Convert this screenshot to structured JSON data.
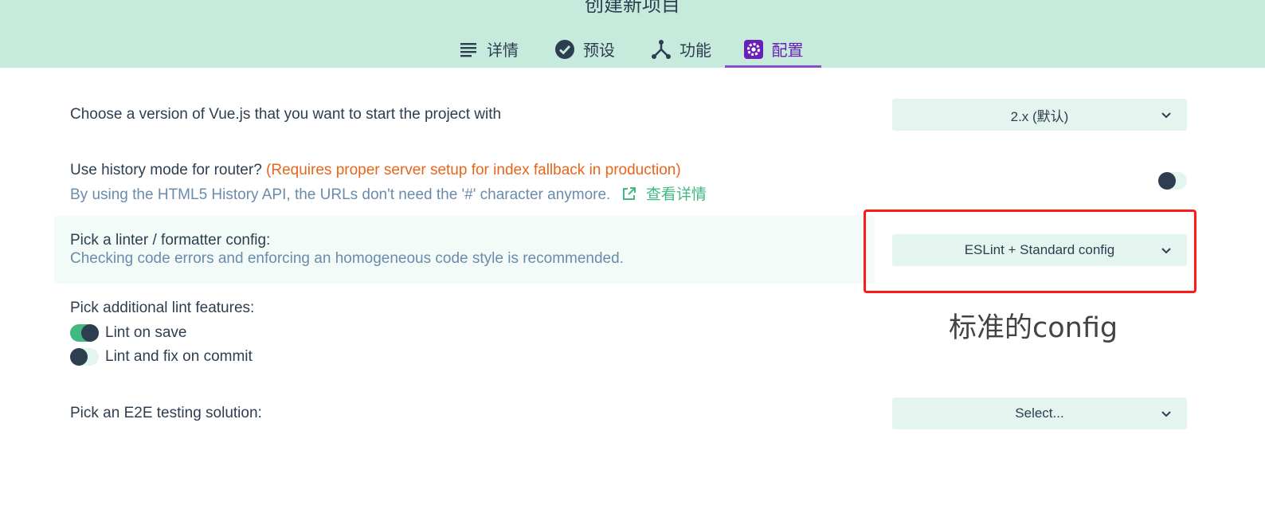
{
  "header": {
    "title": "创建新项目",
    "tabs": [
      {
        "label": "详情",
        "icon": "list-icon"
      },
      {
        "label": "预设",
        "icon": "check-circle-icon"
      },
      {
        "label": "功能",
        "icon": "fork-icon"
      },
      {
        "label": "配置",
        "icon": "gear-icon",
        "active": true
      }
    ]
  },
  "vue_version": {
    "label": "Choose a version of Vue.js that you want to start the project with",
    "selected": "2.x (默认)"
  },
  "router": {
    "label": "Use history mode for router?",
    "warning": "(Requires proper server setup for index fallback in production)",
    "description": "By using the HTML5 History API, the URLs don't need the '#' character anymore.",
    "link_text": "查看详情",
    "toggle_on": false
  },
  "linter": {
    "label": "Pick a linter / formatter config:",
    "description": "Checking code errors and enforcing an homogeneous code style is recommended.",
    "selected": "ESLint + Standard config"
  },
  "lint_features": {
    "label": "Pick additional lint features:",
    "options": [
      {
        "label": "Lint on save",
        "on": true
      },
      {
        "label": "Lint and fix on commit",
        "on": false
      }
    ]
  },
  "e2e": {
    "label": "Pick an E2E testing solution:",
    "selected": "Select..."
  },
  "annotation": {
    "text": "标准的config",
    "color": "#ff1a1a"
  },
  "colors": {
    "header_bg": "#c6ebdd",
    "accent": "#42b983",
    "active_tab": "#6a1fb5",
    "warning": "#e8651a"
  }
}
